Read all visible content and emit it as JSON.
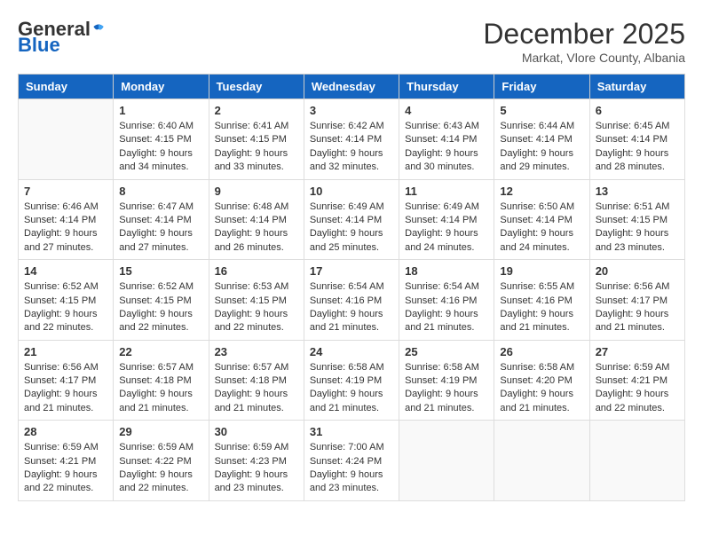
{
  "header": {
    "logo_general": "General",
    "logo_blue": "Blue",
    "month_title": "December 2025",
    "subtitle": "Markat, Vlore County, Albania"
  },
  "days_of_week": [
    "Sunday",
    "Monday",
    "Tuesday",
    "Wednesday",
    "Thursday",
    "Friday",
    "Saturday"
  ],
  "weeks": [
    [
      {
        "day": "",
        "info": ""
      },
      {
        "day": "1",
        "sunrise": "6:40 AM",
        "sunset": "4:15 PM",
        "daylight": "9 hours and 34 minutes."
      },
      {
        "day": "2",
        "sunrise": "6:41 AM",
        "sunset": "4:15 PM",
        "daylight": "9 hours and 33 minutes."
      },
      {
        "day": "3",
        "sunrise": "6:42 AM",
        "sunset": "4:14 PM",
        "daylight": "9 hours and 32 minutes."
      },
      {
        "day": "4",
        "sunrise": "6:43 AM",
        "sunset": "4:14 PM",
        "daylight": "9 hours and 30 minutes."
      },
      {
        "day": "5",
        "sunrise": "6:44 AM",
        "sunset": "4:14 PM",
        "daylight": "9 hours and 29 minutes."
      },
      {
        "day": "6",
        "sunrise": "6:45 AM",
        "sunset": "4:14 PM",
        "daylight": "9 hours and 28 minutes."
      }
    ],
    [
      {
        "day": "7",
        "sunrise": "6:46 AM",
        "sunset": "4:14 PM",
        "daylight": "9 hours and 27 minutes."
      },
      {
        "day": "8",
        "sunrise": "6:47 AM",
        "sunset": "4:14 PM",
        "daylight": "9 hours and 27 minutes."
      },
      {
        "day": "9",
        "sunrise": "6:48 AM",
        "sunset": "4:14 PM",
        "daylight": "9 hours and 26 minutes."
      },
      {
        "day": "10",
        "sunrise": "6:49 AM",
        "sunset": "4:14 PM",
        "daylight": "9 hours and 25 minutes."
      },
      {
        "day": "11",
        "sunrise": "6:49 AM",
        "sunset": "4:14 PM",
        "daylight": "9 hours and 24 minutes."
      },
      {
        "day": "12",
        "sunrise": "6:50 AM",
        "sunset": "4:14 PM",
        "daylight": "9 hours and 24 minutes."
      },
      {
        "day": "13",
        "sunrise": "6:51 AM",
        "sunset": "4:15 PM",
        "daylight": "9 hours and 23 minutes."
      }
    ],
    [
      {
        "day": "14",
        "sunrise": "6:52 AM",
        "sunset": "4:15 PM",
        "daylight": "9 hours and 22 minutes."
      },
      {
        "day": "15",
        "sunrise": "6:52 AM",
        "sunset": "4:15 PM",
        "daylight": "9 hours and 22 minutes."
      },
      {
        "day": "16",
        "sunrise": "6:53 AM",
        "sunset": "4:15 PM",
        "daylight": "9 hours and 22 minutes."
      },
      {
        "day": "17",
        "sunrise": "6:54 AM",
        "sunset": "4:16 PM",
        "daylight": "9 hours and 21 minutes."
      },
      {
        "day": "18",
        "sunrise": "6:54 AM",
        "sunset": "4:16 PM",
        "daylight": "9 hours and 21 minutes."
      },
      {
        "day": "19",
        "sunrise": "6:55 AM",
        "sunset": "4:16 PM",
        "daylight": "9 hours and 21 minutes."
      },
      {
        "day": "20",
        "sunrise": "6:56 AM",
        "sunset": "4:17 PM",
        "daylight": "9 hours and 21 minutes."
      }
    ],
    [
      {
        "day": "21",
        "sunrise": "6:56 AM",
        "sunset": "4:17 PM",
        "daylight": "9 hours and 21 minutes."
      },
      {
        "day": "22",
        "sunrise": "6:57 AM",
        "sunset": "4:18 PM",
        "daylight": "9 hours and 21 minutes."
      },
      {
        "day": "23",
        "sunrise": "6:57 AM",
        "sunset": "4:18 PM",
        "daylight": "9 hours and 21 minutes."
      },
      {
        "day": "24",
        "sunrise": "6:58 AM",
        "sunset": "4:19 PM",
        "daylight": "9 hours and 21 minutes."
      },
      {
        "day": "25",
        "sunrise": "6:58 AM",
        "sunset": "4:19 PM",
        "daylight": "9 hours and 21 minutes."
      },
      {
        "day": "26",
        "sunrise": "6:58 AM",
        "sunset": "4:20 PM",
        "daylight": "9 hours and 21 minutes."
      },
      {
        "day": "27",
        "sunrise": "6:59 AM",
        "sunset": "4:21 PM",
        "daylight": "9 hours and 22 minutes."
      }
    ],
    [
      {
        "day": "28",
        "sunrise": "6:59 AM",
        "sunset": "4:21 PM",
        "daylight": "9 hours and 22 minutes."
      },
      {
        "day": "29",
        "sunrise": "6:59 AM",
        "sunset": "4:22 PM",
        "daylight": "9 hours and 22 minutes."
      },
      {
        "day": "30",
        "sunrise": "6:59 AM",
        "sunset": "4:23 PM",
        "daylight": "9 hours and 23 minutes."
      },
      {
        "day": "31",
        "sunrise": "7:00 AM",
        "sunset": "4:24 PM",
        "daylight": "9 hours and 23 minutes."
      },
      {
        "day": "",
        "info": ""
      },
      {
        "day": "",
        "info": ""
      },
      {
        "day": "",
        "info": ""
      }
    ]
  ],
  "labels": {
    "sunrise": "Sunrise:",
    "sunset": "Sunset:",
    "daylight": "Daylight:"
  }
}
